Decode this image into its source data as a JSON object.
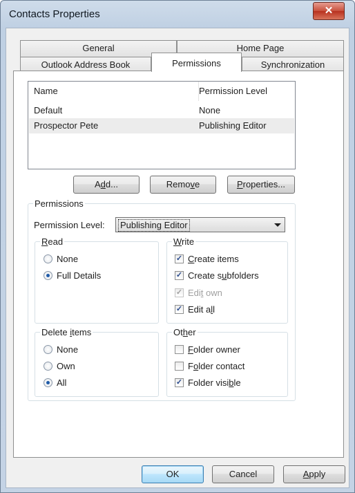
{
  "window": {
    "title": "Contacts Properties",
    "close_glyph": "✕"
  },
  "tabs": {
    "general": "General",
    "home_page": "Home Page",
    "outlook_address_book": "Outlook Address Book",
    "permissions": "Permissions",
    "synchronization": "Synchronization"
  },
  "list": {
    "headers": {
      "name": "Name",
      "level": "Permission Level"
    },
    "rows": [
      {
        "name": "Default",
        "level": "None"
      },
      {
        "name": "Prospector Pete",
        "level": "Publishing Editor"
      }
    ],
    "selected_row": 1
  },
  "buttons": {
    "add": {
      "pre": "A",
      "mn": "d",
      "post": "d..."
    },
    "remove": {
      "pre": "Remo",
      "mn": "v",
      "post": "e"
    },
    "properties": {
      "pre": "",
      "mn": "P",
      "post": "roperties..."
    }
  },
  "permissions": {
    "group_label": "Permissions",
    "level_label": "Permission Level:",
    "level_value": "Publishing Editor",
    "read": {
      "label": {
        "pre": "",
        "mn": "R",
        "post": "ead"
      },
      "none": "None",
      "full_details": "Full Details",
      "selected": "Full Details"
    },
    "write": {
      "label": {
        "pre": "",
        "mn": "W",
        "post": "rite"
      },
      "create_items": {
        "pre": "",
        "mn": "C",
        "post": "reate items",
        "checked": true,
        "enabled": true
      },
      "create_subfolders": {
        "pre": "Create s",
        "mn": "u",
        "post": "bfolders",
        "checked": true,
        "enabled": true
      },
      "edit_own": {
        "pre": "Edi",
        "mn": "t",
        "post": " own",
        "checked": true,
        "enabled": false
      },
      "edit_all": {
        "pre": "Edit a",
        "mn": "l",
        "post": "l",
        "checked": true,
        "enabled": true
      }
    },
    "delete_items": {
      "label": {
        "pre": "Delete ",
        "mn": "i",
        "post": "tems"
      },
      "none": "None",
      "own": "Own",
      "all": "All",
      "selected": "All"
    },
    "other": {
      "label": {
        "pre": "Ot",
        "mn": "h",
        "post": "er"
      },
      "folder_owner": {
        "pre": "",
        "mn": "F",
        "post": "older owner",
        "checked": false
      },
      "folder_contact": {
        "pre": "F",
        "mn": "o",
        "post": "lder contact",
        "checked": false
      },
      "folder_visible": {
        "pre": "Folder visi",
        "mn": "b",
        "post": "le",
        "checked": true
      }
    }
  },
  "dialog_buttons": {
    "ok": "OK",
    "cancel": "Cancel",
    "apply": {
      "pre": "",
      "mn": "A",
      "post": "pply"
    }
  },
  "colors": {
    "accent_radio": "#1e5aa8",
    "close_button": "#c8503c",
    "default_button_border": "#3c7fb1"
  }
}
